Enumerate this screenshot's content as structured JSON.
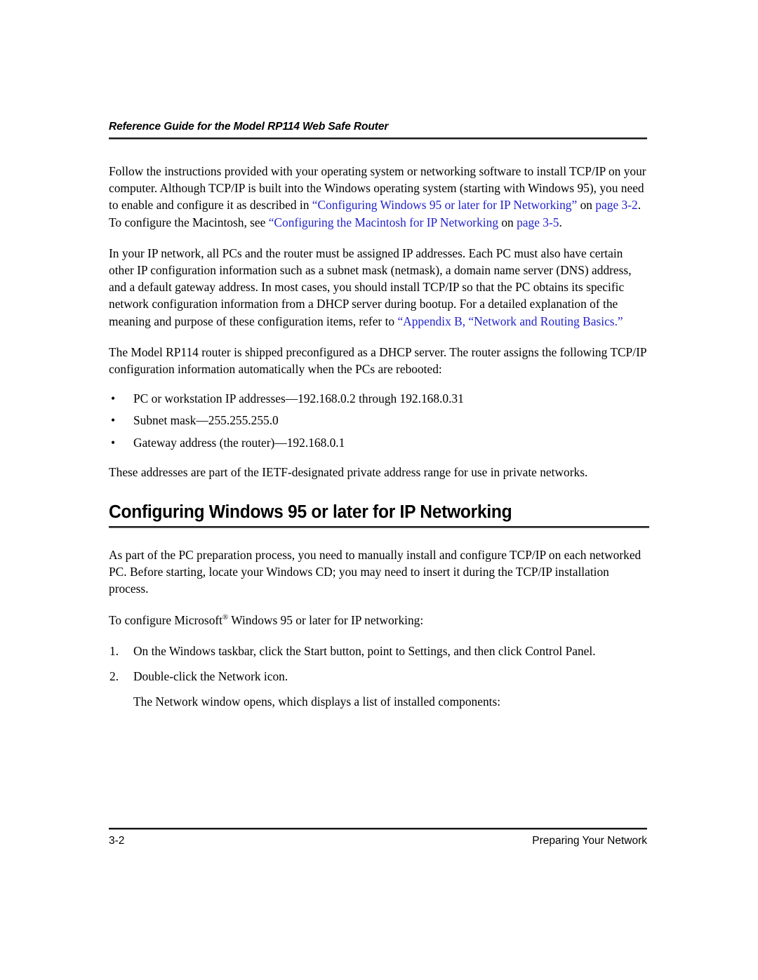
{
  "header": {
    "running_title": "Reference Guide for the Model RP114 Web Safe Router"
  },
  "body": {
    "para1": {
      "seg1": "Follow the instructions provided with your operating system or networking software to install TCP/IP on your computer. Although TCP/IP is built into the Windows operating system (starting with Windows 95), you need to enable and configure it as described in ",
      "link1": "“Configuring Windows 95 or later for IP Networking”",
      "seg2": " on ",
      "link2": "page 3-2",
      "seg3": ". To configure the Macintosh, see ",
      "link3": "“Configuring the Macintosh for IP Networking",
      "seg4": " on ",
      "link4": "page 3-5",
      "seg5": "."
    },
    "para2": {
      "seg1": "In your IP network, all PCs and the router must be assigned IP addresses. Each PC must also have certain other IP configuration information such as a subnet mask (netmask), a domain name server (DNS) address, and a default gateway address. In most cases, you should install TCP/IP so that the PC obtains its specific network configuration information from a DHCP server during bootup. For a detailed explanation of the meaning and purpose of these configuration items, refer to ",
      "link1": "“Appendix B, “Network and Routing Basics.”"
    },
    "para3": "The Model RP114 router is shipped preconfigured as a DHCP server. The router assigns the following TCP/IP configuration information automatically when the PCs are rebooted:",
    "bullet_mark": "•",
    "bullets": [
      "PC or workstation IP addresses—192.168.0.2 through 192.168.0.31",
      "Subnet mask—255.255.255.0",
      "Gateway address (the router)—192.168.0.1"
    ],
    "para4": "These addresses are part of the IETF-designated private address range for use in private networks."
  },
  "section": {
    "heading": "Configuring Windows 95 or later for IP Networking",
    "para1": "As part of the PC preparation process, you need to manually install and configure TCP/IP on each networked PC. Before starting, locate your Windows CD; you may need to insert it during the TCP/IP installation process.",
    "intro_before_reg": "To configure Microsoft",
    "registered_mark": "®",
    "intro_after_reg": " Windows 95 or later for IP networking:",
    "steps": [
      {
        "num": "1.",
        "text": "On the Windows taskbar, click the Start button, point to Settings, and then click Control Panel."
      },
      {
        "num": "2.",
        "text": "Double-click the Network icon."
      }
    ],
    "step_followup": "The Network window opens, which displays a list of installed components:"
  },
  "footer": {
    "page_number": "3-2",
    "section_name": "Preparing Your Network"
  },
  "colors": {
    "link": "#2222cc",
    "text": "#000000",
    "rule_dark": "#1a1a1a",
    "rule_light": "#8a8a8a",
    "page_background": "#ffffff"
  }
}
